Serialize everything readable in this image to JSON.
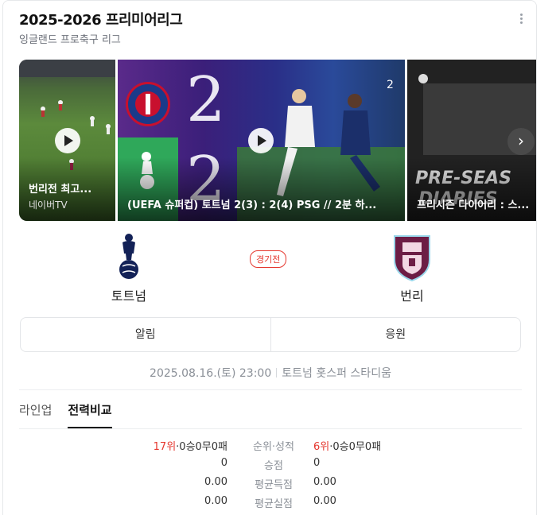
{
  "header": {
    "title": "2025-2026 프리미어리그",
    "subtitle": "잉글랜드 프로축구 리그"
  },
  "videos": [
    {
      "title": "번리전 최고...",
      "source": "네이버TV"
    },
    {
      "title": "(UEFA 슈퍼컵) 토트넘 2(3) : 2(4) PSG // 2분 하...",
      "score_top": "2",
      "score_bottom": "2"
    },
    {
      "title": "프리시즌 다이어리 : 스..."
    }
  ],
  "match": {
    "home_team": "토트넘",
    "away_team": "번리",
    "status": "경기전",
    "datetime": "2025.08.16.(토) 23:00",
    "venue": "토트넘 홋스퍼 스타디움"
  },
  "actions": {
    "notify": "알림",
    "cheer": "응원"
  },
  "tabs": [
    {
      "label": "라인업",
      "active": false
    },
    {
      "label": "전력비교",
      "active": true
    }
  ],
  "stats": {
    "rows": [
      {
        "home_rank": "17위",
        "home_value": "·0승0무0패",
        "label": "순위·성적",
        "away_rank": "6위",
        "away_value": "·0승0무0패"
      },
      {
        "home_rank": "",
        "home_value": "0",
        "label": "승점",
        "away_rank": "",
        "away_value": "0"
      },
      {
        "home_rank": "",
        "home_value": "0.00",
        "label": "평균득점",
        "away_rank": "",
        "away_value": "0.00"
      },
      {
        "home_rank": "",
        "home_value": "0.00",
        "label": "평균실점",
        "away_rank": "",
        "away_value": "0.00"
      }
    ]
  },
  "colors": {
    "accent_red": "#e5372e",
    "spurs_navy": "#132257",
    "burnley_claret": "#6c1d45"
  }
}
